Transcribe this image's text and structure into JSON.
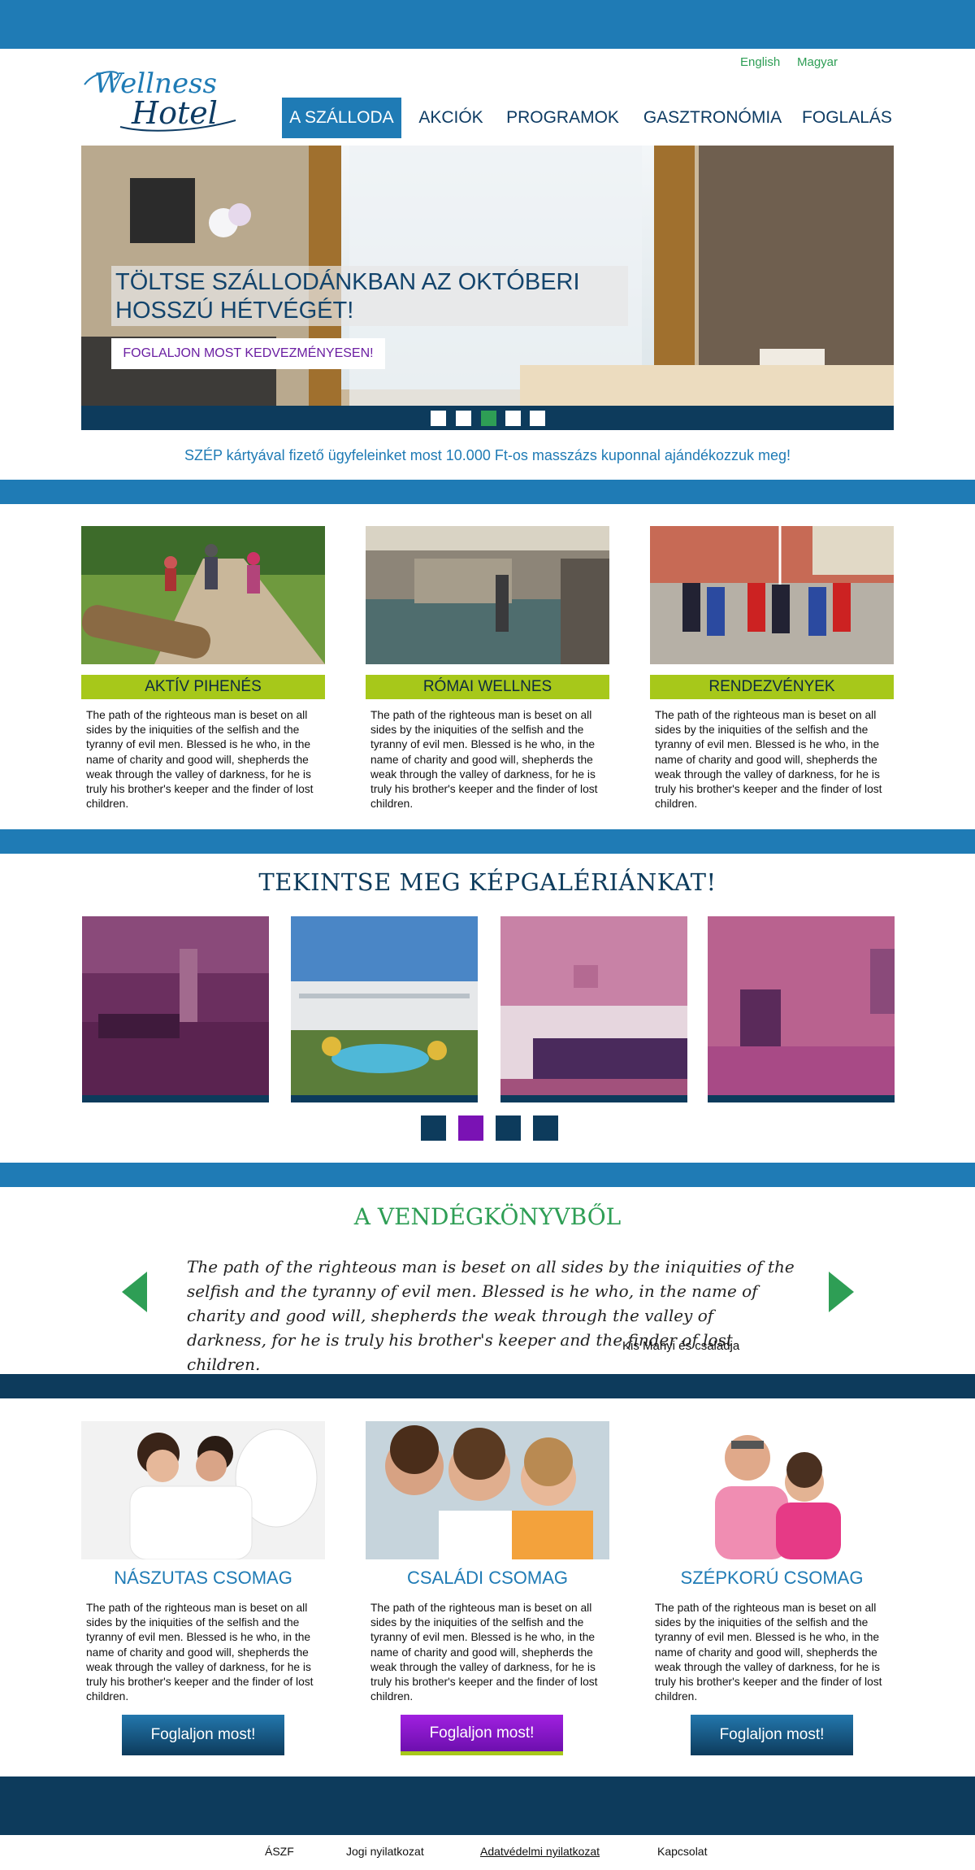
{
  "header": {
    "languages": [
      "English",
      "Magyar"
    ],
    "logo_line1": "Wellness",
    "logo_line2": "Hotel",
    "nav": [
      "A SZÁLLODA",
      "AKCIÓK",
      "PROGRAMOK",
      "GASZTRONÓMIA",
      "FOGLALÁS"
    ],
    "active_nav": "A SZÁLLODA"
  },
  "hero": {
    "title_line1": "TÖLTSE SZÁLLODÁNKBAN AZ OKTÓBERI",
    "title_line2": "HOSSZÚ HÉTVÉGÉT!",
    "button": "FOGLALJON MOST KEDVEZMÉNYESEN!",
    "slides_total": 5,
    "active_slide": 3
  },
  "promo": "SZÉP kártyával fizető ügyfeleinket most 10.000 Ft-os masszázs kuponnal ajándékozzuk meg!",
  "features": [
    {
      "title": "AKTÍV PIHENÉS",
      "text": "The path of the righteous man is beset on all sides by the iniquities of the selfish and the tyranny of evil men. Blessed is he who, in the name of charity and good will, shepherds the weak through the valley of darkness, for he is truly his brother's keeper and the finder of lost children."
    },
    {
      "title": "RÓMAI WELLNES",
      "text": "The path of the righteous man is beset on all sides by the iniquities of the selfish and the tyranny of evil men. Blessed is he who, in the name of charity and good will, shepherds the weak through the valley of darkness, for he is truly his brother's keeper and the finder of lost children."
    },
    {
      "title": "RENDEZVÉNYEK",
      "text": "The path of the righteous man is beset on all sides by the iniquities of the selfish and the tyranny of evil men. Blessed is he who, in the name of charity and good will, shepherds the weak through the valley of darkness, for he is truly his brother's keeper and the finder of lost children."
    }
  ],
  "gallery": {
    "title": "TEKINTSE MEG KÉPGALÉRIÁNKAT!",
    "pages_total": 4,
    "active_page": 2
  },
  "guestbook": {
    "title": "A VENDÉGKÖNYVBŐL",
    "quote": "The path of the righteous man is beset on all sides by the iniquities of the selfish and the tyranny of evil men. Blessed is he who, in the name of charity and good will, shepherds the weak through the valley of darkness, for he is truly his brother's keeper and the finder of lost children.",
    "author": "Kis Manyi és családja"
  },
  "packages": [
    {
      "title": "NÁSZUTAS CSOMAG",
      "text": "The path of the righteous man is beset on all sides by the iniquities of the selfish and the tyranny of evil men. Blessed is he who, in the name of charity and good will, shepherds the weak through the valley of darkness, for he is truly his brother's keeper and the finder of lost children.",
      "button": "Foglaljon most!"
    },
    {
      "title": "CSALÁDI CSOMAG",
      "text": "The path of the righteous man is beset on all sides by the iniquities of the selfish and the tyranny of evil men. Blessed is he who, in the name of charity and good will, shepherds the weak through the valley of darkness, for he is truly his brother's keeper and the finder of lost children.",
      "button": "Foglaljon most!"
    },
    {
      "title": "SZÉPKORÚ CSOMAG",
      "text": "The path of the righteous man is beset on all sides by the iniquities of the selfish and the tyranny of evil men. Blessed is he who, in the name of charity and good will, shepherds the weak through the valley of darkness, for he is truly his brother's keeper and the finder of lost children.",
      "button": "Foglaljon most!"
    }
  ],
  "footer": {
    "links": [
      "ÁSZF",
      "Jogi nyilatkozat",
      "Adatvédelmi nyilatkozat",
      "Kapcsolat"
    ]
  },
  "colors": {
    "brand_blue": "#1f7bb5",
    "navy": "#0d3b5c",
    "green": "#2e9e55",
    "lime": "#a7c81a",
    "purple": "#7a12b4"
  }
}
